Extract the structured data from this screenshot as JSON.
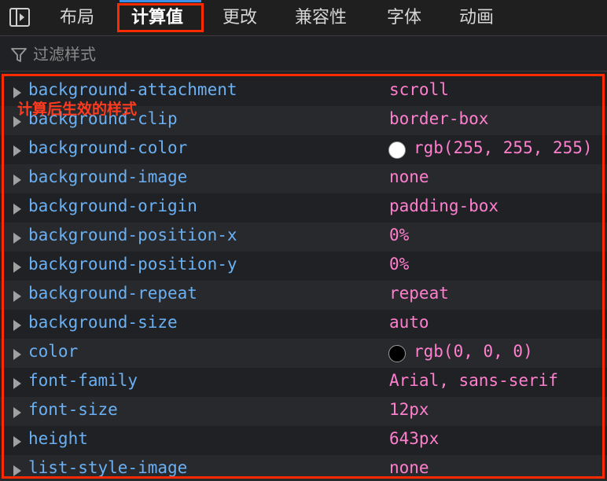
{
  "tabs": [
    {
      "label": "布局"
    },
    {
      "label": "计算值"
    },
    {
      "label": "更改"
    },
    {
      "label": "兼容性"
    },
    {
      "label": "字体"
    },
    {
      "label": "动画"
    }
  ],
  "active_tab": "计算值",
  "filter": {
    "placeholder": "过滤样式",
    "value": ""
  },
  "annotation": "计算后生效的样式",
  "highlight_color": "#ff2a00",
  "properties": [
    {
      "name": "background-attachment",
      "value": "scroll"
    },
    {
      "name": "background-clip",
      "value": "border-box"
    },
    {
      "name": "background-color",
      "value": "rgb(255, 255, 255)",
      "swatch": "#ffffff"
    },
    {
      "name": "background-image",
      "value": "none"
    },
    {
      "name": "background-origin",
      "value": "padding-box"
    },
    {
      "name": "background-position-x",
      "value": "0%"
    },
    {
      "name": "background-position-y",
      "value": "0%"
    },
    {
      "name": "background-repeat",
      "value": "repeat"
    },
    {
      "name": "background-size",
      "value": "auto"
    },
    {
      "name": "color",
      "value": "rgb(0, 0, 0)",
      "swatch": "#000000"
    },
    {
      "name": "font-family",
      "value": "Arial, sans-serif"
    },
    {
      "name": "font-size",
      "value": "12px"
    },
    {
      "name": "height",
      "value": "643px"
    },
    {
      "name": "list-style-image",
      "value": "none"
    }
  ]
}
